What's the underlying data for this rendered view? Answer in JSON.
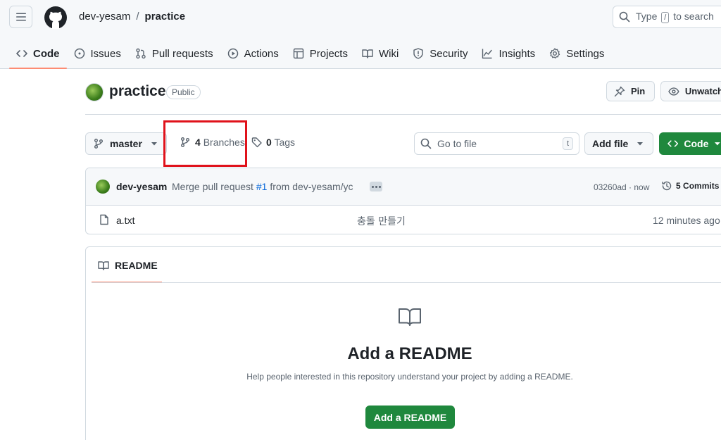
{
  "header": {
    "owner": "dev-yesam",
    "separator": "/",
    "repo": "practice",
    "search_prefix": "Type",
    "search_key": "/",
    "search_suffix": "to search"
  },
  "tabs": [
    {
      "label": "Code",
      "icon": "code-icon",
      "active": true
    },
    {
      "label": "Issues",
      "icon": "issue-icon"
    },
    {
      "label": "Pull requests",
      "icon": "pull-request-icon"
    },
    {
      "label": "Actions",
      "icon": "play-icon"
    },
    {
      "label": "Projects",
      "icon": "table-icon"
    },
    {
      "label": "Wiki",
      "icon": "book-icon"
    },
    {
      "label": "Security",
      "icon": "shield-icon"
    },
    {
      "label": "Insights",
      "icon": "graph-icon"
    },
    {
      "label": "Settings",
      "icon": "gear-icon"
    }
  ],
  "repo_header": {
    "title": "practice",
    "visibility": "Public",
    "pin_label": "Pin",
    "watch_label": "Unwatch"
  },
  "controls": {
    "branch": "master",
    "branches_count": "4",
    "branches_label": "Branches",
    "tags_count": "0",
    "tags_label": "Tags",
    "goto_placeholder": "Go to file",
    "goto_key": "t",
    "add_file_label": "Add file",
    "code_label": "Code",
    "highlight_color": "#e0121b"
  },
  "commit": {
    "author": "dev-yesam",
    "message_prefix": "Merge pull request",
    "pr_number": "#1",
    "message_suffix": "from dev-yesam/yc",
    "hash_time": "03260ad · now",
    "commits_count": "5",
    "commits_label": "Commits"
  },
  "files": [
    {
      "name": "a.txt",
      "message": "충돌 만들기",
      "time": "12 minutes ago"
    }
  ],
  "readme": {
    "tab_label": "README",
    "heading": "Add a README",
    "help": "Help people interested in this repository understand your project by adding a README.",
    "button_label": "Add a README"
  },
  "colors": {
    "accent_green": "#1f883d",
    "tab_underline": "#fd8c73",
    "link_blue": "#0969da"
  }
}
